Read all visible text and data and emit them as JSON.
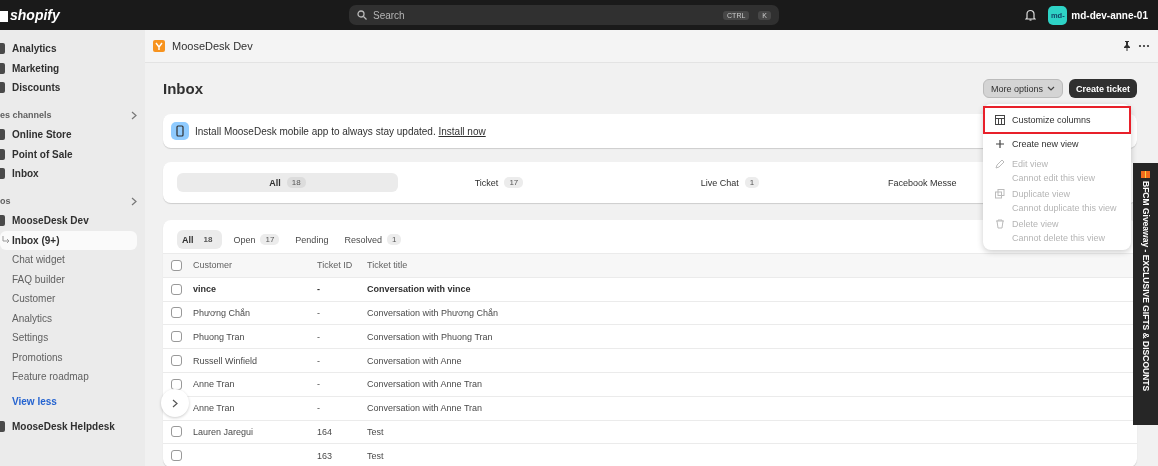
{
  "topbar": {
    "logo": "shopify",
    "search": {
      "placeholder": "Search",
      "keys": [
        "CTRL",
        "K"
      ]
    },
    "user": {
      "avatar": "md-",
      "name": "md-dev-anne-01"
    }
  },
  "sidebar": {
    "items": [
      {
        "kind": "nav",
        "label": "Analytics",
        "selected": false
      },
      {
        "kind": "nav",
        "label": "Marketing",
        "selected": false
      },
      {
        "kind": "nav",
        "label": "Discounts",
        "selected": false
      },
      {
        "kind": "heading",
        "label": "es channels"
      },
      {
        "kind": "nav",
        "label": "Online Store",
        "selected": false
      },
      {
        "kind": "nav",
        "label": "Point of Sale",
        "selected": false
      },
      {
        "kind": "nav",
        "label": "Inbox",
        "selected": false
      },
      {
        "kind": "heading",
        "label": "os"
      },
      {
        "kind": "nav",
        "label": "MooseDesk Dev",
        "selected": false
      },
      {
        "kind": "sub",
        "label": "Inbox (9+)",
        "selected": true
      },
      {
        "kind": "sub",
        "label": "Chat widget",
        "selected": false
      },
      {
        "kind": "sub",
        "label": "FAQ builder",
        "selected": false
      },
      {
        "kind": "sub",
        "label": "Customer",
        "selected": false
      },
      {
        "kind": "sub",
        "label": "Analytics",
        "selected": false
      },
      {
        "kind": "sub",
        "label": "Settings",
        "selected": false
      },
      {
        "kind": "sub",
        "label": "Promotions",
        "selected": false
      },
      {
        "kind": "sub",
        "label": "Feature roadmap",
        "selected": false
      },
      {
        "kind": "link",
        "label": "View less"
      },
      {
        "kind": "nav",
        "label": "MooseDesk Helpdesk",
        "selected": false
      }
    ]
  },
  "app_header": {
    "title": "MooseDesk Dev"
  },
  "page": {
    "title": "Inbox",
    "buttons": [
      {
        "label": "More options",
        "kind": "secondary"
      },
      {
        "label": "Create ticket",
        "kind": "primary"
      }
    ]
  },
  "banner": {
    "text": "Install MooseDesk mobile app to always stay updated.",
    "link": "Install now"
  },
  "channel_tabs": [
    {
      "label": "All",
      "count": "18",
      "selected": true
    },
    {
      "label": "Ticket",
      "count": "17",
      "selected": false
    },
    {
      "label": "Live Chat",
      "count": "1",
      "selected": false
    },
    {
      "label": "Facebook Messe",
      "selected": false
    }
  ],
  "status_tabs": [
    {
      "label": "All",
      "count": "18",
      "selected": true
    },
    {
      "label": "Open",
      "count": "17",
      "selected": false
    },
    {
      "label": "Pending",
      "selected": false
    },
    {
      "label": "Resolved",
      "count": "1",
      "selected": false
    }
  ],
  "table": {
    "select_all_checked": false,
    "columns": [
      "Customer",
      "Ticket ID",
      "Ticket title"
    ],
    "rows": [
      {
        "customer": "vince",
        "ticket_id": "-",
        "title": "Conversation with vince",
        "unread": true,
        "checked": false
      },
      {
        "customer": "Phương Chắn",
        "ticket_id": "-",
        "title": "Conversation with Phương Chắn",
        "unread": false,
        "checked": false
      },
      {
        "customer": "Phuong Tran",
        "ticket_id": "-",
        "title": "Conversation with Phuong Tran",
        "unread": false,
        "checked": false
      },
      {
        "customer": "Russell Winfield",
        "ticket_id": "-",
        "title": "Conversation with Anne",
        "unread": false,
        "checked": false
      },
      {
        "customer": "Anne Tran",
        "ticket_id": "-",
        "title": "Conversation with Anne Tran",
        "unread": false,
        "checked": false
      },
      {
        "customer": "Anne Tran",
        "ticket_id": "-",
        "title": "Conversation with Anne Tran",
        "unread": false
      },
      {
        "customer": "Lauren Jaregui",
        "ticket_id": "164",
        "title": "Test",
        "unread": false,
        "checked": false
      },
      {
        "customer": "",
        "ticket_id": "163",
        "title": "Test",
        "unread": false,
        "checked": false
      }
    ]
  },
  "menu": {
    "items": [
      {
        "kind": "table",
        "label": "Customize columns",
        "highlighted": true,
        "disabled": false
      },
      {
        "kind": "plus",
        "label": "Create new view",
        "highlighted": false,
        "disabled": false
      },
      {
        "kind": "pencil",
        "label": "Edit view",
        "note": "Cannot edit this view",
        "highlighted": false,
        "disabled": true
      },
      {
        "kind": "copy",
        "label": "Duplicate view",
        "note": "Cannot duplicate this view",
        "highlighted": false,
        "disabled": true
      },
      {
        "kind": "trash",
        "label": "Delete view",
        "note": "Cannot delete this view",
        "highlighted": false,
        "disabled": true
      }
    ]
  },
  "promo_tab": {
    "text": "BFCM Giveaway - EXCLUSIVE GIFTS & DISCOUNTS"
  }
}
